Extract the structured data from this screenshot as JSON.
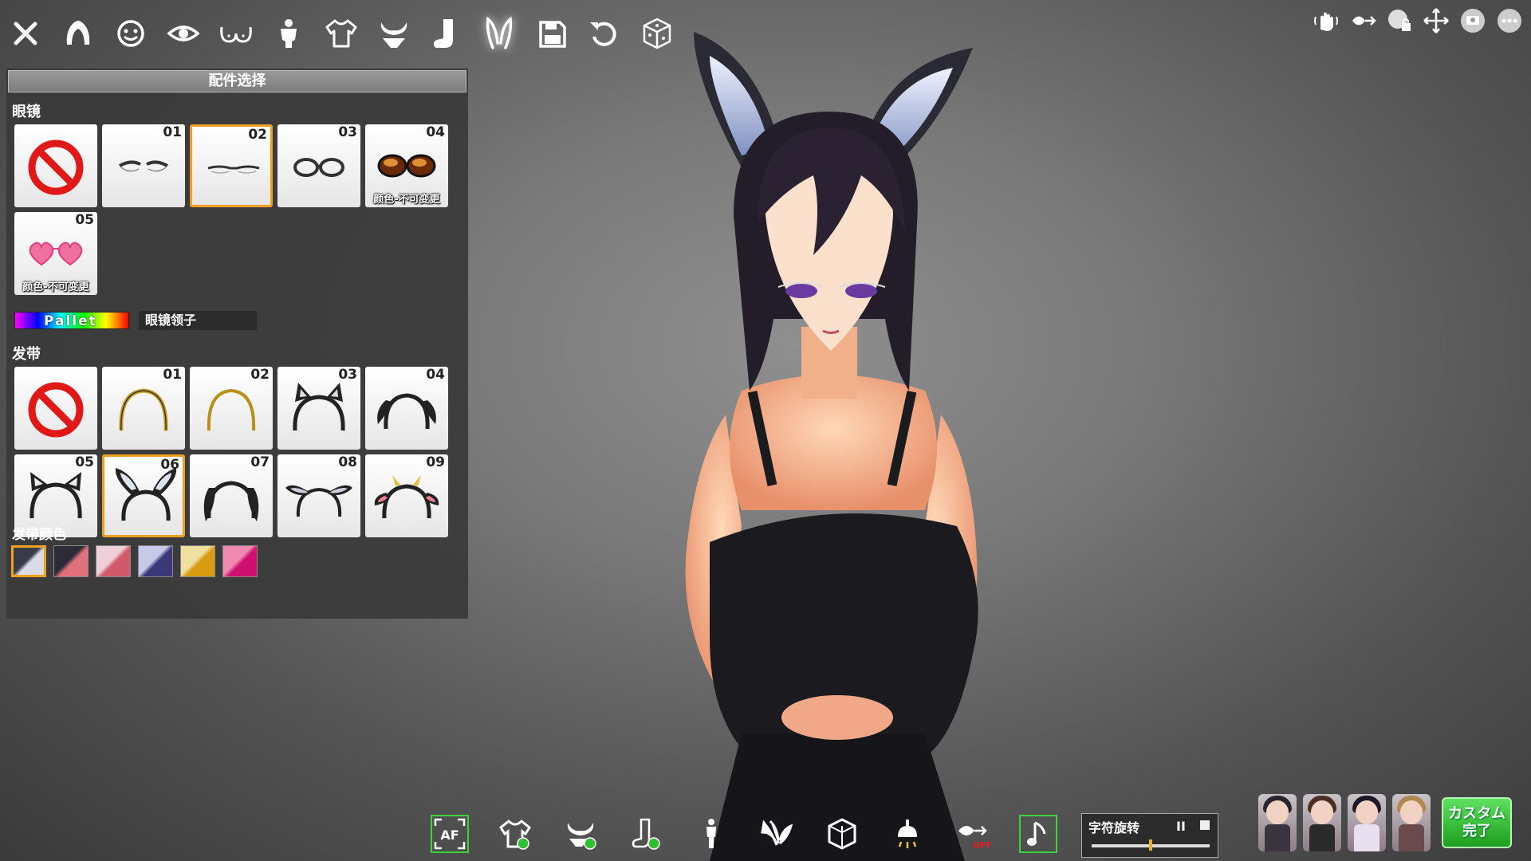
{
  "toolbar": {
    "items": [
      {
        "icon": "close-icon"
      },
      {
        "icon": "hair-icon"
      },
      {
        "icon": "face-icon"
      },
      {
        "icon": "eye-icon"
      },
      {
        "icon": "chest-icon"
      },
      {
        "icon": "body-icon"
      },
      {
        "icon": "shirt-icon"
      },
      {
        "icon": "underwear-icon"
      },
      {
        "icon": "sock-icon"
      },
      {
        "icon": "bunny-ears-icon",
        "active": true
      },
      {
        "icon": "save-icon"
      },
      {
        "icon": "undo-icon"
      },
      {
        "icon": "random-dice-icon"
      }
    ]
  },
  "panel": {
    "title": "配件选择",
    "glasses": {
      "label": "眼镜",
      "tiles": [
        {
          "num": "",
          "icon": "none-icon"
        },
        {
          "num": "01",
          "icon": "half-rim-glasses-icon"
        },
        {
          "num": "02",
          "icon": "rimless-glasses-icon",
          "selected": true
        },
        {
          "num": "03",
          "icon": "round-glasses-icon"
        },
        {
          "num": "04",
          "icon": "sunglasses-icon",
          "caption": "颜色-不可变更"
        },
        {
          "num": "05",
          "icon": "heart-glasses-icon",
          "caption": "颜色-不可变更"
        }
      ]
    },
    "pallet": {
      "label": "Pallet",
      "target": "眼镜领子"
    },
    "headband": {
      "label": "发带",
      "tiles": [
        {
          "num": "",
          "icon": "none-icon"
        },
        {
          "num": "01",
          "icon": "gold-headband-icon"
        },
        {
          "num": "02",
          "icon": "thin-headband-icon"
        },
        {
          "num": "03",
          "icon": "cat-ears-headband-icon"
        },
        {
          "num": "04",
          "icon": "floppy-ears-headband-icon"
        },
        {
          "num": "05",
          "icon": "cat-ears-white-headband-icon"
        },
        {
          "num": "06",
          "icon": "bunny-ears-headband-icon",
          "selected": true
        },
        {
          "num": "07",
          "icon": "dog-ears-headband-icon"
        },
        {
          "num": "08",
          "icon": "lop-ears-headband-icon"
        },
        {
          "num": "09",
          "icon": "cow-ears-headband-icon"
        }
      ]
    },
    "headband_color": {
      "label": "发带颜色",
      "swatches": [
        {
          "a": "#3a3a4a",
          "b": "#d8dbe8",
          "selected": true
        },
        {
          "a": "#2c2c38",
          "b": "#e0707a"
        },
        {
          "a": "#f0d0d8",
          "b": "#d05a6a"
        },
        {
          "a": "#c8c8e8",
          "b": "#3a3878"
        },
        {
          "a": "#f0e0a0",
          "b": "#d89a10"
        },
        {
          "a": "#f08ab0",
          "b": "#d01070"
        }
      ]
    }
  },
  "topright": {
    "items": [
      {
        "icon": "touch-hand-icon"
      },
      {
        "icon": "gaze-follow-icon"
      },
      {
        "icon": "camera-lock-icon"
      },
      {
        "icon": "move-icon"
      },
      {
        "icon": "screenshot-icon"
      },
      {
        "icon": "more-icon"
      }
    ]
  },
  "bottombar": {
    "items": [
      {
        "icon": "autofocus-icon",
        "label": "AF",
        "boxed": true
      },
      {
        "icon": "clothing-toggle-icon"
      },
      {
        "icon": "underwear-toggle-icon"
      },
      {
        "icon": "socks-toggle-icon"
      },
      {
        "icon": "pose-icon"
      },
      {
        "icon": "expression-icon"
      },
      {
        "icon": "background-icon"
      },
      {
        "icon": "light-icon"
      },
      {
        "icon": "gaze-off-icon",
        "label": "OFF"
      },
      {
        "icon": "music-note-icon",
        "boxed": true
      }
    ],
    "rotate": {
      "label": "字符旋转",
      "pause": "II",
      "value": 0.48
    }
  },
  "presets": [
    {
      "name": "preset-1",
      "hair": "#2a2430",
      "body": "#3a3440"
    },
    {
      "name": "preset-2",
      "hair": "#4a3020",
      "body": "#2a2a2a"
    },
    {
      "name": "preset-3",
      "hair": "#201828",
      "body": "#e8e0f0"
    },
    {
      "name": "preset-4",
      "hair": "#b08850",
      "body": "#6a4a4a"
    }
  ],
  "finish_label": "カスタム\n完了"
}
